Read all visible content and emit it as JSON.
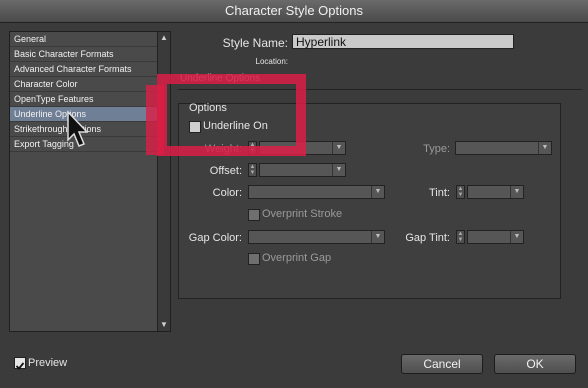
{
  "window": {
    "title": "Character Style Options"
  },
  "sidebar": {
    "items": [
      {
        "label": "General"
      },
      {
        "label": "Basic Character Formats"
      },
      {
        "label": "Advanced Character Formats"
      },
      {
        "label": "Character Color"
      },
      {
        "label": "OpenType Features"
      },
      {
        "label": "Underline Options"
      },
      {
        "label": "Strikethrough Options"
      },
      {
        "label": "Export Tagging"
      }
    ],
    "selected_index": 5
  },
  "header": {
    "style_name_label": "Style Name:",
    "style_name_value": "Hyperlink",
    "location_label": "Location:"
  },
  "section": {
    "title": "Underline Options",
    "options_heading": "Options",
    "underline_on_label": "Underline On",
    "weight_label": "Weight:",
    "type_label": "Type:",
    "offset_label": "Offset:",
    "color_label": "Color:",
    "tint_label": "Tint:",
    "overprint_stroke_label": "Overprint Stroke",
    "gap_color_label": "Gap Color:",
    "gap_tint_label": "Gap Tint:",
    "overprint_gap_label": "Overprint Gap"
  },
  "footer": {
    "preview_label": "Preview",
    "cancel_label": "Cancel",
    "ok_label": "OK"
  },
  "colors": {
    "highlight": "#dc1e46",
    "selection": "#6f7f96"
  },
  "icons": {
    "stepper": "up-down-arrows",
    "dropdown": "chevron-down"
  }
}
